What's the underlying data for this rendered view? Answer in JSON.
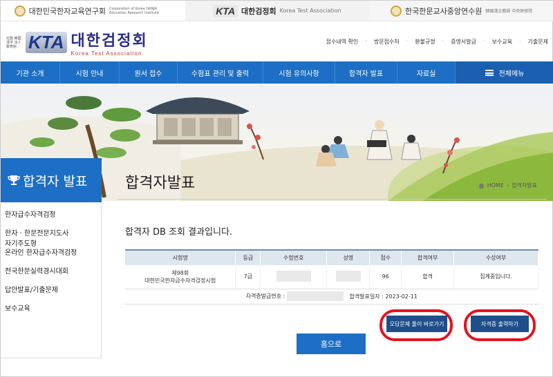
{
  "topbar": {
    "left_name": "대한민국한자교육연구회",
    "left_sub": "Corporation of Korea HANJA Education Research Institute",
    "mid_logo": "KTA",
    "mid_name": "대한검정회",
    "mid_sub": "Korea Test Association",
    "right_name": "한국한문교사중앙연수원",
    "right_sub": "韓國漢文教師 中央硏修院"
  },
  "header": {
    "logo_sub": "社團 韓國漢字 法人 敎育館",
    "logo_kta": "KTA",
    "logo_ko": "대한검정회",
    "logo_en": "Korea Test Association",
    "util_links": [
      "접수내역 확인",
      "방문접수처",
      "환불규정",
      "증명서발급",
      "보수교육",
      "기출문제"
    ]
  },
  "nav": {
    "items": [
      "기관 소개",
      "시험 안내",
      "원서 접수",
      "수험표 관리 및 출력",
      "시험 유의사항",
      "합격자 발표",
      "자료실"
    ],
    "all_menu": "전체메뉴"
  },
  "sidebar": {
    "title": "합격자 발표",
    "items": [
      "한자급수자격검정",
      "한자 · 한문전문지도사",
      "자기주도형\n온라인 한자급수자격검정",
      "전국한문실력경시대회",
      "답안발표/기출문제",
      "보수교육"
    ]
  },
  "content": {
    "page_title": "합격자발표",
    "crumb_home": "HOME",
    "crumb_current": "합격자발표",
    "result_heading": "합격자 DB 조회 결과입니다.",
    "table": {
      "headers": [
        "시험명",
        "등급",
        "수험번호",
        "성명",
        "점수",
        "합격여부",
        "수상여부"
      ],
      "row": {
        "exam_line1": "제98회",
        "exam_line2": "대한민국한자급수자격검정시험",
        "grade": "7급",
        "score": "96",
        "pass": "합격",
        "award": "집계중입니다."
      },
      "cert_label": "자격증발급번호 :",
      "announce": "합격발표일자 : 2023-02-11"
    },
    "btn_review": "오답문제 풀이 바로가기",
    "btn_print": "자격증 출력하기",
    "btn_home": "홈으로"
  },
  "colors": {
    "nav_blue": "#1c6fc4",
    "dark_button": "#1f4f8a",
    "highlight_red": "#e5121e"
  }
}
